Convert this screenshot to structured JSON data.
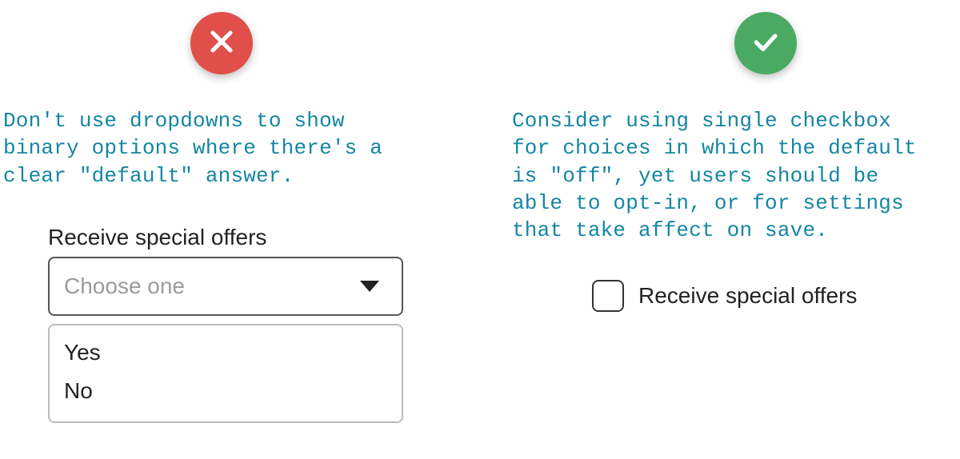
{
  "colors": {
    "advice_text": "#1486a3",
    "bad": "#e04f4a",
    "good": "#4aaa64"
  },
  "left": {
    "icon": "cross-icon",
    "advice": "Don't use dropdowns to show\nbinary options where there's a\nclear \"default\" answer.",
    "field_label": "Receive special offers",
    "select_placeholder": "Choose one",
    "options": [
      "Yes",
      "No"
    ]
  },
  "right": {
    "icon": "check-icon",
    "advice": "Consider using single checkbox\nfor choices in which the default\nis \"off\", yet users should be\nable to opt-in, or for settings\nthat take affect on save.",
    "checkbox_label": "Receive special offers",
    "checkbox_checked": false
  }
}
